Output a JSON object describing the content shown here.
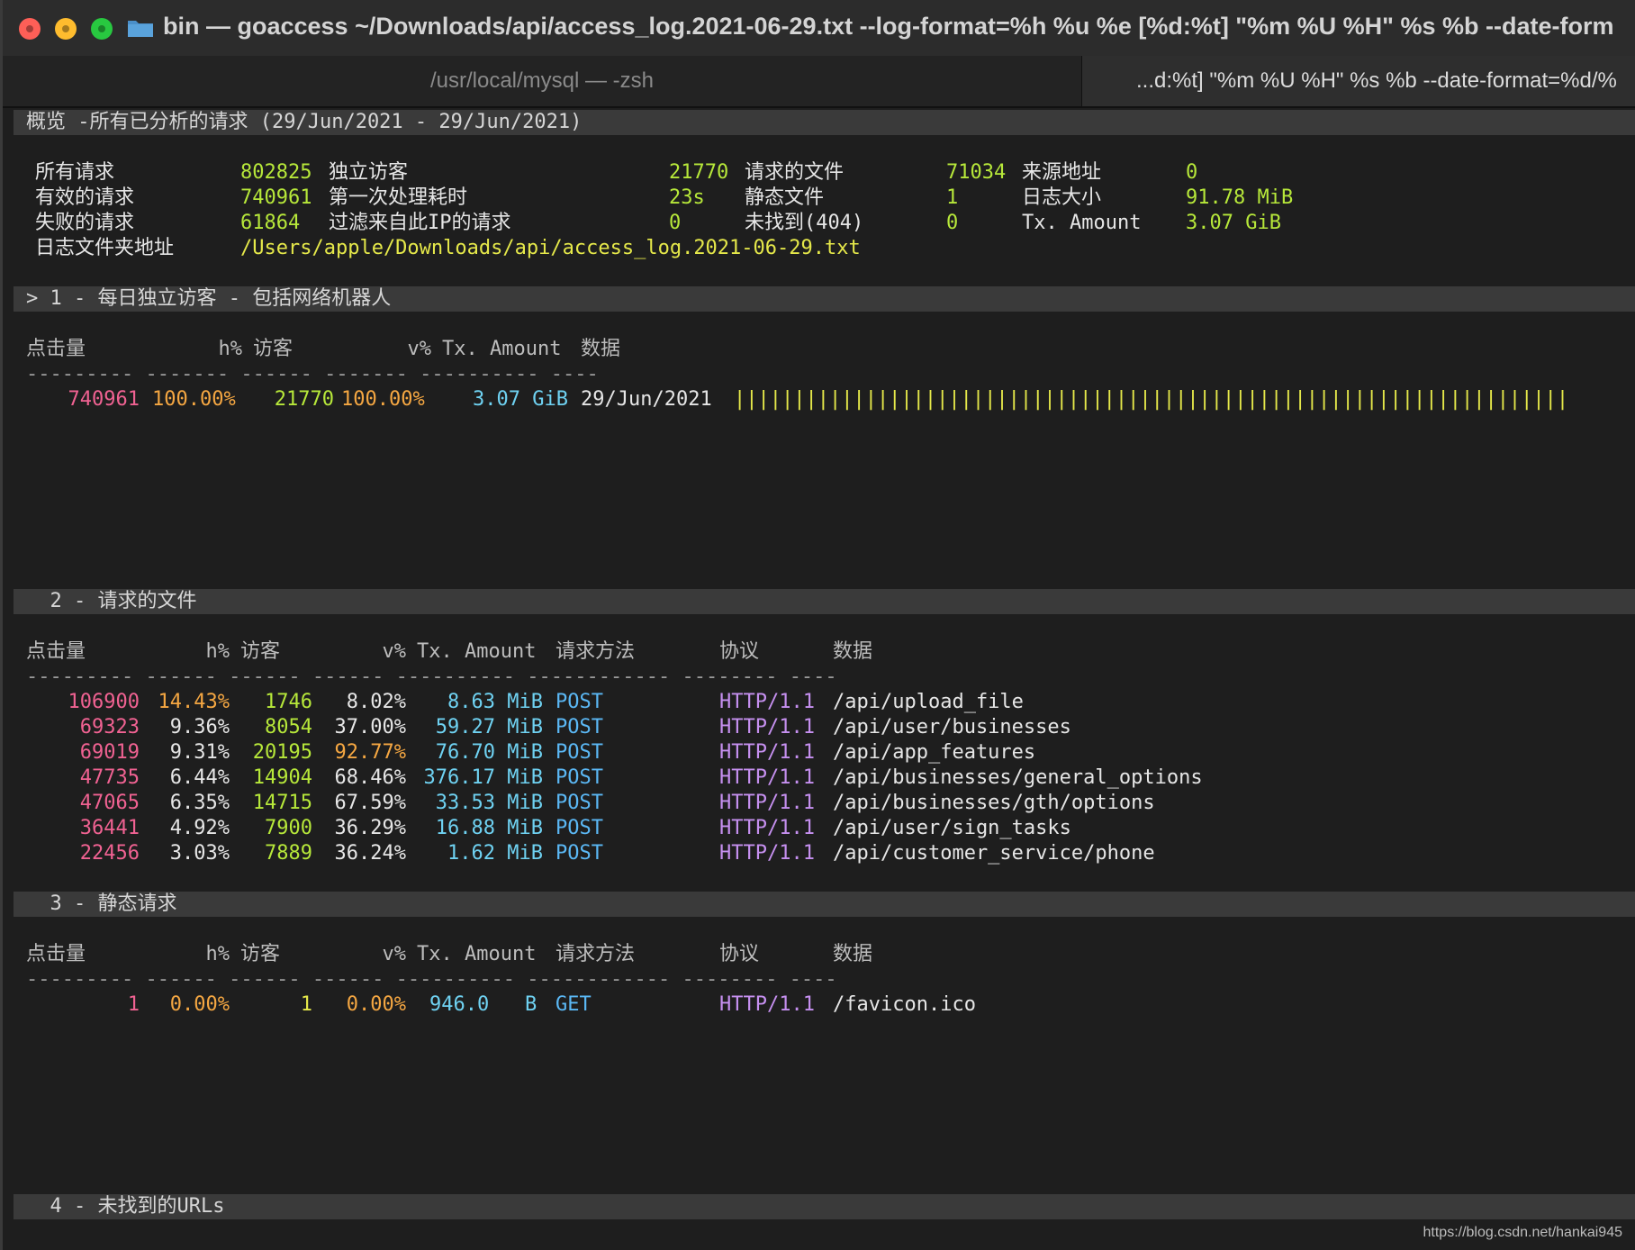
{
  "window": {
    "title": "bin — goaccess ~/Downloads/api/access_log.2021-06-29.txt --log-format=%h %u %e [%d:%t] \"%m %U %H\" %s %b --date-form"
  },
  "tabs": [
    {
      "label": "/usr/local/mysql — -zsh"
    },
    {
      "label": "...d:%t] \"%m %U %H\" %s %b --date-format=%d/%"
    }
  ],
  "overview": {
    "header": "概览 -所有已分析的请求 (29/Jun/2021 - 29/Jun/2021)",
    "stats": [
      {
        "label": "所有请求",
        "value": "802825"
      },
      {
        "label": "有效的请求",
        "value": "740961"
      },
      {
        "label": "失败的请求",
        "value": "61864"
      },
      {
        "label": "独立访客",
        "value": "21770"
      },
      {
        "label": "第一次处理耗时",
        "value": "23s"
      },
      {
        "label": "过滤来自此IP的请求",
        "value": "0"
      },
      {
        "label": "请求的文件",
        "value": "71034"
      },
      {
        "label": "静态文件",
        "value": "1"
      },
      {
        "label": "未找到(404)",
        "value": "0"
      },
      {
        "label": "来源地址",
        "value": "0"
      },
      {
        "label": "日志大小",
        "value": "91.78 MiB"
      },
      {
        "label": "Tx. Amount",
        "value": "3.07 GiB"
      }
    ],
    "logfile_label": "日志文件夹地址",
    "logfile_path": "/Users/apple/Downloads/api/access_log.2021-06-29.txt"
  },
  "panel1": {
    "header": "> 1 - 每日独立访客 - 包括网络机器人",
    "columns": [
      "点击量",
      "h%",
      "访客",
      "v%",
      "Tx. Amount",
      "数据"
    ],
    "dashes": "--------- ------- ------ ------- ---------- ----",
    "rows": [
      {
        "hits": "740961",
        "h_pct": "100.00%",
        "visitors": "21770",
        "v_pct": "100.00%",
        "tx": "3.07 GiB",
        "data": "29/Jun/2021",
        "bar": "||||||||||||||||||||||||||||||||||||||||||||||||||||||||||||||||||||||"
      }
    ]
  },
  "panel2": {
    "header": "  2 - 请求的文件",
    "columns": [
      "点击量",
      "h%",
      "访客",
      "v%",
      "Tx. Amount",
      "请求方法",
      "协议",
      "数据"
    ],
    "dashes": "--------- ------ ------ ------ ---------- ------------ -------- ----",
    "rows": [
      {
        "hits": "106900",
        "h_pct": "14.43%",
        "visitors": "1746",
        "v_pct": "8.02%",
        "tx": "8.63 MiB",
        "method": "POST",
        "protocol": "HTTP/1.1",
        "data": "/api/upload_file"
      },
      {
        "hits": "69323",
        "h_pct": "9.36%",
        "visitors": "8054",
        "v_pct": "37.00%",
        "tx": "59.27 MiB",
        "method": "POST",
        "protocol": "HTTP/1.1",
        "data": "/api/user/businesses"
      },
      {
        "hits": "69019",
        "h_pct": "9.31%",
        "visitors": "20195",
        "v_pct": "92.77%",
        "tx": "76.70 MiB",
        "method": "POST",
        "protocol": "HTTP/1.1",
        "data": "/api/app_features"
      },
      {
        "hits": "47735",
        "h_pct": "6.44%",
        "visitors": "14904",
        "v_pct": "68.46%",
        "tx": "376.17 MiB",
        "method": "POST",
        "protocol": "HTTP/1.1",
        "data": "/api/businesses/general_options"
      },
      {
        "hits": "47065",
        "h_pct": "6.35%",
        "visitors": "14715",
        "v_pct": "67.59%",
        "tx": "33.53 MiB",
        "method": "POST",
        "protocol": "HTTP/1.1",
        "data": "/api/businesses/gth/options"
      },
      {
        "hits": "36441",
        "h_pct": "4.92%",
        "visitors": "7900",
        "v_pct": "36.29%",
        "tx": "16.88 MiB",
        "method": "POST",
        "protocol": "HTTP/1.1",
        "data": "/api/user/sign_tasks"
      },
      {
        "hits": "22456",
        "h_pct": "3.03%",
        "visitors": "7889",
        "v_pct": "36.24%",
        "tx": "1.62 MiB",
        "method": "POST",
        "protocol": "HTTP/1.1",
        "data": "/api/customer_service/phone"
      }
    ]
  },
  "panel3": {
    "header": "  3 - 静态请求",
    "columns": [
      "点击量",
      "h%",
      "访客",
      "v%",
      "Tx. Amount",
      "请求方法",
      "协议",
      "数据"
    ],
    "dashes": "--------- ------ ------ ------ ---------- ------------ -------- ----",
    "rows": [
      {
        "hits": "1",
        "h_pct": "0.00%",
        "visitors": "1",
        "v_pct": "0.00%",
        "tx": "946.0   B",
        "method": "GET",
        "protocol": "HTTP/1.1",
        "data": "/favicon.ico"
      }
    ]
  },
  "panel4": {
    "header": "  4 - 未找到的URLs"
  },
  "watermark": "https://blog.csdn.net/hankai945"
}
